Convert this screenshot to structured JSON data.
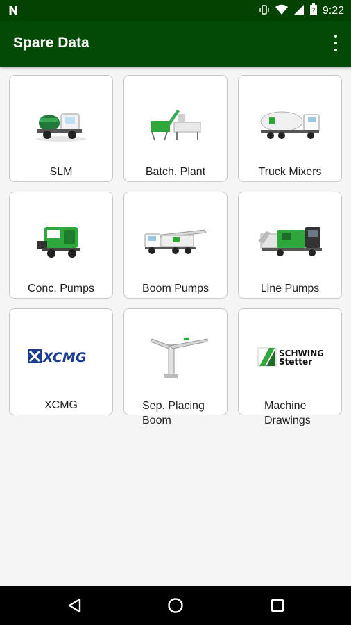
{
  "status_bar": {
    "time": "9:22"
  },
  "app_bar": {
    "title": "Spare Data"
  },
  "tiles": [
    {
      "label": "SLM"
    },
    {
      "label": "Batch. Plant"
    },
    {
      "label": "Truck Mixers"
    },
    {
      "label": "Conc. Pumps"
    },
    {
      "label": "Boom Pumps"
    },
    {
      "label": "Line Pumps"
    },
    {
      "label": "XCMG",
      "logo_text": "XCMG"
    },
    {
      "label_line1": "Sep. Placing",
      "label_line2": "Boom"
    },
    {
      "label_line1": "Machine",
      "label_line2": "Drawings",
      "logo_line1": "SCHWING",
      "logo_line2": "Stetter"
    }
  ],
  "colors": {
    "app_bar": "#034a04",
    "status_bar": "#034200",
    "accent_green": "#2ea83a"
  }
}
